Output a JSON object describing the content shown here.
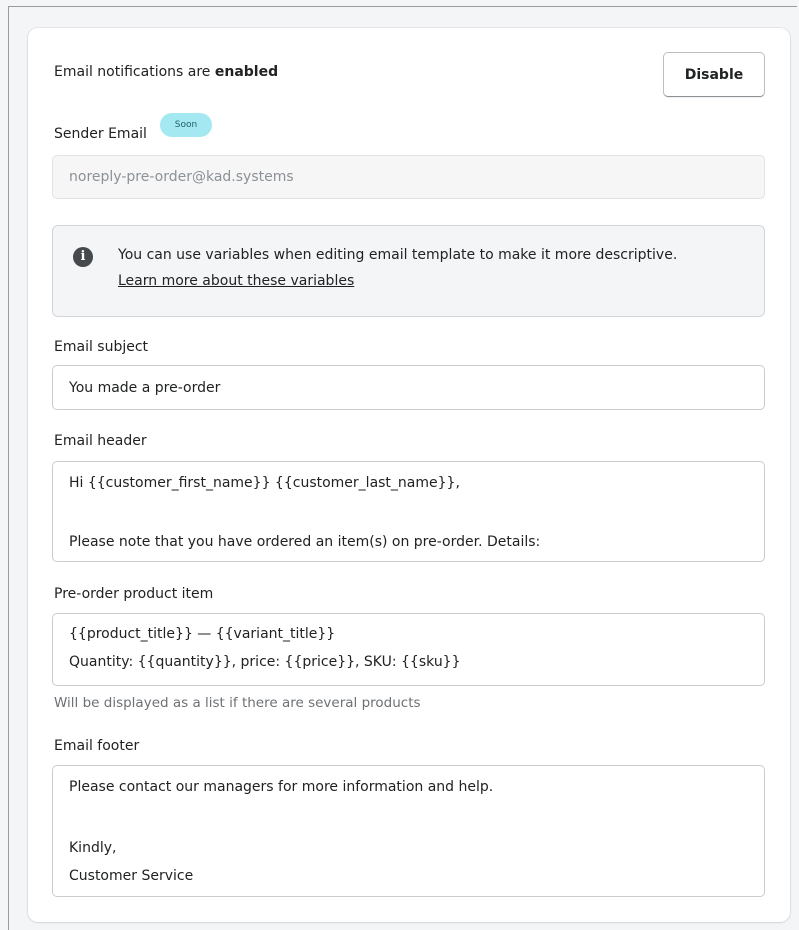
{
  "notifications": {
    "status_prefix": "Email notifications are",
    "status_value": "enabled",
    "disable_label": "Disable"
  },
  "sender": {
    "label": "Sender Email",
    "badge": "Soon",
    "value": "noreply-pre-order@kad.systems"
  },
  "banner": {
    "icon": "info-icon",
    "text": "You can use variables when editing email template to make it more descriptive.",
    "link": "Learn more about these variables"
  },
  "subject": {
    "label": "Email subject",
    "value": "You made a pre-order"
  },
  "header": {
    "label": "Email header",
    "line1": "Hi  {{customer_first_name}} {{customer_last_name}},",
    "line2": "Please note that you have ordered an item(s) on pre-order. Details:"
  },
  "product_item": {
    "label": "Pre-order product item",
    "line1": "{{product_title}} — {{variant_title}}",
    "line2": "Quantity: {{quantity}}, price: {{price}}, SKU: {{sku}}",
    "help": "Will be displayed as a list if there are several products"
  },
  "footer": {
    "label": "Email footer",
    "line1": "Please contact our managers for more information and help.",
    "line2": "Kindly,",
    "line3": "Customer Service"
  }
}
